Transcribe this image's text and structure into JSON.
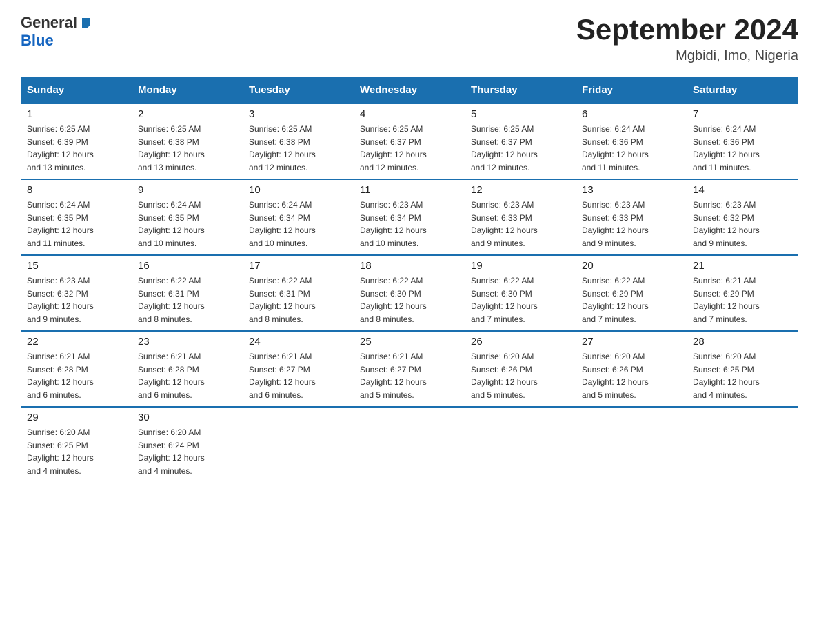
{
  "header": {
    "logo_general": "General",
    "logo_blue": "Blue",
    "title": "September 2024",
    "subtitle": "Mgbidi, Imo, Nigeria"
  },
  "weekdays": [
    "Sunday",
    "Monday",
    "Tuesday",
    "Wednesday",
    "Thursday",
    "Friday",
    "Saturday"
  ],
  "weeks": [
    [
      {
        "day": "1",
        "sunrise": "6:25 AM",
        "sunset": "6:39 PM",
        "daylight": "12 hours and 13 minutes."
      },
      {
        "day": "2",
        "sunrise": "6:25 AM",
        "sunset": "6:38 PM",
        "daylight": "12 hours and 13 minutes."
      },
      {
        "day": "3",
        "sunrise": "6:25 AM",
        "sunset": "6:38 PM",
        "daylight": "12 hours and 12 minutes."
      },
      {
        "day": "4",
        "sunrise": "6:25 AM",
        "sunset": "6:37 PM",
        "daylight": "12 hours and 12 minutes."
      },
      {
        "day": "5",
        "sunrise": "6:25 AM",
        "sunset": "6:37 PM",
        "daylight": "12 hours and 12 minutes."
      },
      {
        "day": "6",
        "sunrise": "6:24 AM",
        "sunset": "6:36 PM",
        "daylight": "12 hours and 11 minutes."
      },
      {
        "day": "7",
        "sunrise": "6:24 AM",
        "sunset": "6:36 PM",
        "daylight": "12 hours and 11 minutes."
      }
    ],
    [
      {
        "day": "8",
        "sunrise": "6:24 AM",
        "sunset": "6:35 PM",
        "daylight": "12 hours and 11 minutes."
      },
      {
        "day": "9",
        "sunrise": "6:24 AM",
        "sunset": "6:35 PM",
        "daylight": "12 hours and 10 minutes."
      },
      {
        "day": "10",
        "sunrise": "6:24 AM",
        "sunset": "6:34 PM",
        "daylight": "12 hours and 10 minutes."
      },
      {
        "day": "11",
        "sunrise": "6:23 AM",
        "sunset": "6:34 PM",
        "daylight": "12 hours and 10 minutes."
      },
      {
        "day": "12",
        "sunrise": "6:23 AM",
        "sunset": "6:33 PM",
        "daylight": "12 hours and 9 minutes."
      },
      {
        "day": "13",
        "sunrise": "6:23 AM",
        "sunset": "6:33 PM",
        "daylight": "12 hours and 9 minutes."
      },
      {
        "day": "14",
        "sunrise": "6:23 AM",
        "sunset": "6:32 PM",
        "daylight": "12 hours and 9 minutes."
      }
    ],
    [
      {
        "day": "15",
        "sunrise": "6:23 AM",
        "sunset": "6:32 PM",
        "daylight": "12 hours and 9 minutes."
      },
      {
        "day": "16",
        "sunrise": "6:22 AM",
        "sunset": "6:31 PM",
        "daylight": "12 hours and 8 minutes."
      },
      {
        "day": "17",
        "sunrise": "6:22 AM",
        "sunset": "6:31 PM",
        "daylight": "12 hours and 8 minutes."
      },
      {
        "day": "18",
        "sunrise": "6:22 AM",
        "sunset": "6:30 PM",
        "daylight": "12 hours and 8 minutes."
      },
      {
        "day": "19",
        "sunrise": "6:22 AM",
        "sunset": "6:30 PM",
        "daylight": "12 hours and 7 minutes."
      },
      {
        "day": "20",
        "sunrise": "6:22 AM",
        "sunset": "6:29 PM",
        "daylight": "12 hours and 7 minutes."
      },
      {
        "day": "21",
        "sunrise": "6:21 AM",
        "sunset": "6:29 PM",
        "daylight": "12 hours and 7 minutes."
      }
    ],
    [
      {
        "day": "22",
        "sunrise": "6:21 AM",
        "sunset": "6:28 PM",
        "daylight": "12 hours and 6 minutes."
      },
      {
        "day": "23",
        "sunrise": "6:21 AM",
        "sunset": "6:28 PM",
        "daylight": "12 hours and 6 minutes."
      },
      {
        "day": "24",
        "sunrise": "6:21 AM",
        "sunset": "6:27 PM",
        "daylight": "12 hours and 6 minutes."
      },
      {
        "day": "25",
        "sunrise": "6:21 AM",
        "sunset": "6:27 PM",
        "daylight": "12 hours and 5 minutes."
      },
      {
        "day": "26",
        "sunrise": "6:20 AM",
        "sunset": "6:26 PM",
        "daylight": "12 hours and 5 minutes."
      },
      {
        "day": "27",
        "sunrise": "6:20 AM",
        "sunset": "6:26 PM",
        "daylight": "12 hours and 5 minutes."
      },
      {
        "day": "28",
        "sunrise": "6:20 AM",
        "sunset": "6:25 PM",
        "daylight": "12 hours and 4 minutes."
      }
    ],
    [
      {
        "day": "29",
        "sunrise": "6:20 AM",
        "sunset": "6:25 PM",
        "daylight": "12 hours and 4 minutes."
      },
      {
        "day": "30",
        "sunrise": "6:20 AM",
        "sunset": "6:24 PM",
        "daylight": "12 hours and 4 minutes."
      },
      null,
      null,
      null,
      null,
      null
    ]
  ],
  "labels": {
    "sunrise": "Sunrise:",
    "sunset": "Sunset:",
    "daylight": "Daylight:"
  }
}
